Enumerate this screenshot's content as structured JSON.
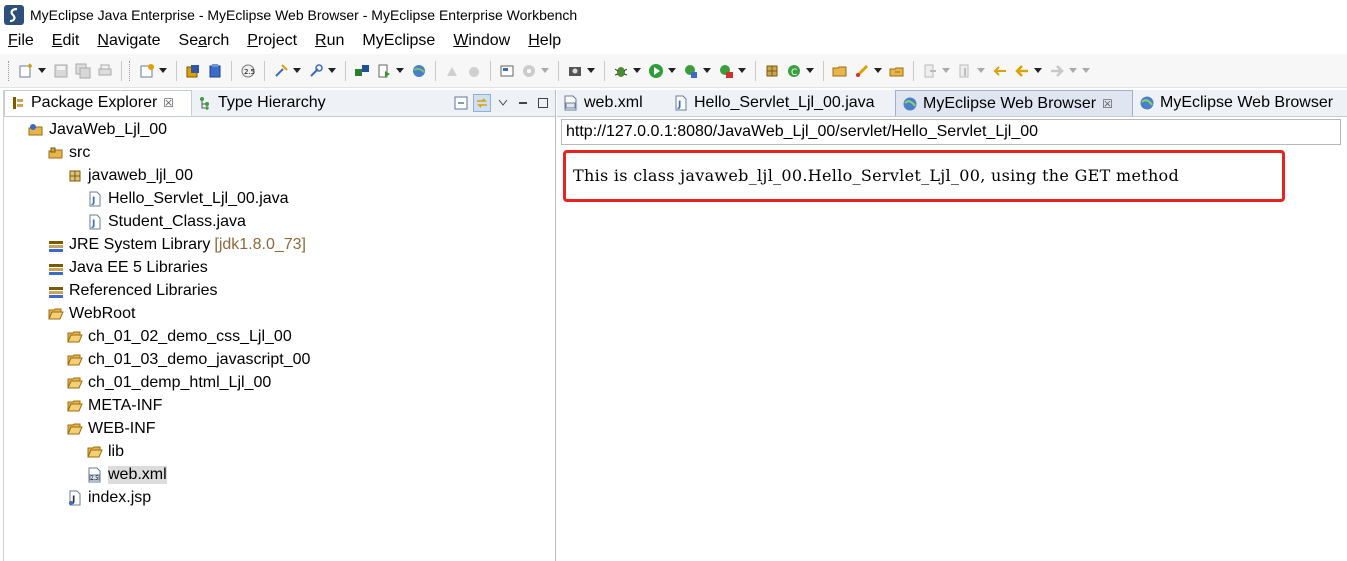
{
  "window": {
    "title": "MyEclipse Java Enterprise - MyEclipse Web Browser - MyEclipse Enterprise Workbench"
  },
  "menubar": {
    "items": [
      {
        "mnemonic": "F",
        "rest": "ile"
      },
      {
        "mnemonic": "E",
        "rest": "dit"
      },
      {
        "mnemonic": "N",
        "rest": "avigate"
      },
      {
        "mnemonic": "",
        "rest": "Se",
        "mn2": "a",
        "rest2": "rch"
      },
      {
        "mnemonic": "P",
        "rest": "roject"
      },
      {
        "mnemonic": "R",
        "rest": "un"
      },
      {
        "mnemonic": "",
        "rest": "MyEclipse"
      },
      {
        "mnemonic": "W",
        "rest": "indow"
      },
      {
        "mnemonic": "H",
        "rest": "elp"
      }
    ]
  },
  "left_view": {
    "tabs": [
      {
        "label": "Package Explorer",
        "close": "☒"
      },
      {
        "label": "Type Hierarchy"
      }
    ],
    "tree": [
      {
        "label": "JavaWeb_Ljl_00",
        "icon": "project-icon",
        "depth": 0
      },
      {
        "label": "src",
        "icon": "source-folder-icon",
        "depth": 1
      },
      {
        "label": "javaweb_ljl_00",
        "icon": "package-icon",
        "depth": 2
      },
      {
        "label": "Hello_Servlet_Ljl_00.java",
        "icon": "java-file-icon",
        "depth": 3
      },
      {
        "label": "Student_Class.java",
        "icon": "java-file-icon",
        "depth": 3
      },
      {
        "label": "JRE System Library",
        "sub": "[jdk1.8.0_73]",
        "icon": "library-icon",
        "depth": 1
      },
      {
        "label": "Java EE 5 Libraries",
        "icon": "library-icon",
        "depth": 1
      },
      {
        "label": "Referenced Libraries",
        "icon": "library-icon",
        "depth": 1
      },
      {
        "label": "WebRoot",
        "icon": "folder-open-icon",
        "depth": 1
      },
      {
        "label": "ch_01_02_demo_css_Ljl_00",
        "icon": "folder-icon",
        "depth": 2
      },
      {
        "label": "ch_01_03_demo_javascript_00",
        "icon": "folder-icon",
        "depth": 2
      },
      {
        "label": "ch_01_demp_html_Ljl_00",
        "icon": "folder-icon",
        "depth": 2
      },
      {
        "label": "META-INF",
        "icon": "folder-icon",
        "depth": 2
      },
      {
        "label": "WEB-INF",
        "icon": "folder-open-icon",
        "depth": 2
      },
      {
        "label": "lib",
        "icon": "folder-icon",
        "depth": 3
      },
      {
        "label": "web.xml",
        "icon": "xml-file-icon",
        "depth": 3,
        "selected": true
      },
      {
        "label": "index.jsp",
        "icon": "jsp-file-icon",
        "depth": 2
      }
    ]
  },
  "editor": {
    "tabs": [
      {
        "label": "web.xml",
        "icon": "xml-file-icon"
      },
      {
        "label": "Hello_Servlet_Ljl_00.java",
        "icon": "java-file-icon"
      },
      {
        "label": "MyEclipse Web Browser",
        "icon": "globe-icon",
        "active": true,
        "close": "☒"
      },
      {
        "label": "MyEclipse Web Browser",
        "icon": "globe-icon"
      }
    ],
    "url": "http://127.0.0.1:8080/JavaWeb_Ljl_00/servlet/Hello_Servlet_Ljl_00",
    "content": "This is class javaweb_ljl_00.Hello_Servlet_Ljl_00, using the GET method"
  },
  "colors": {
    "highlight_border": "#e8231e",
    "selection": "#dcdcdc",
    "tab_bar": "#eef1f6"
  }
}
